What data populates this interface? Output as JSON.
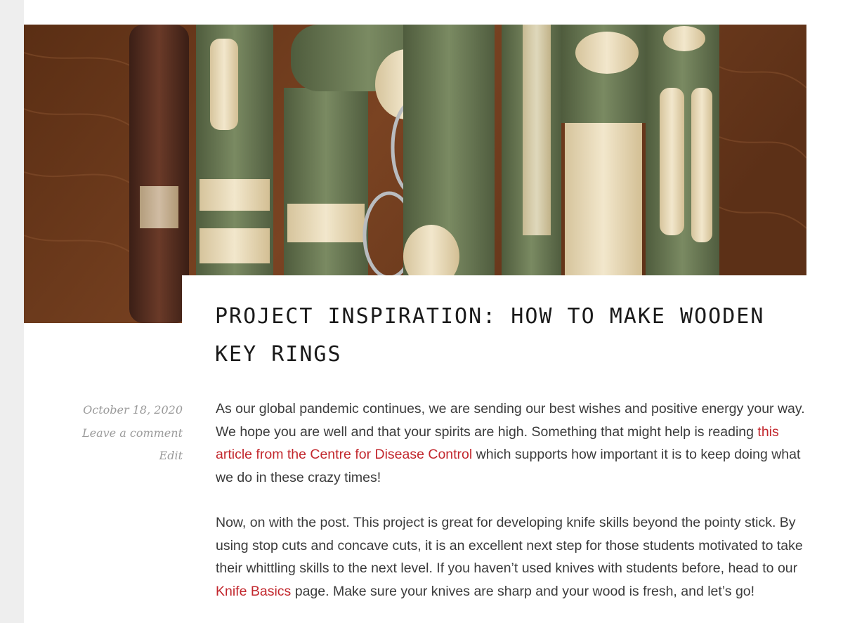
{
  "hero": {
    "image": "wooden-key-rings-photo",
    "colors": {
      "wood_table": "#6b3a1c",
      "bark_green": "#6d7b57",
      "peeled_wood": "#e6d6b3",
      "dark_bark": "#4a2a1e",
      "ring_metal": "#b9bcbf"
    }
  },
  "post": {
    "title": "Project Inspiration: How to make wooden key rings",
    "meta": {
      "date": "October 18, 2020",
      "comment_link": "Leave a comment",
      "edit_link": "Edit"
    },
    "paragraph1": {
      "before": "As our global pandemic continues, we are sending our best wishes and positive energy your way. We hope you are well and that your spirits are high. Something that might help is reading ",
      "link": "this article from the Centre for Disease Control",
      "after": " which supports how important it is to keep doing what we do in these crazy times!"
    },
    "paragraph2": {
      "before": "Now, on with the post. This project is great for developing knife skills beyond the pointy stick. By using stop cuts and concave cuts, it is an excellent next step for those students motivated to take their whittling skills to the next level. If you haven’t used knives with students before, head to our ",
      "link": "Knife Basics",
      "after": " page. Make sure your knives are sharp and your wood is fresh, and let’s go!"
    }
  },
  "colors": {
    "link": "#c2272d",
    "meta_text": "#9a9a9a",
    "body_text": "#3b3b3b",
    "title_text": "#1a1a1a",
    "gutter": "#eeeeee"
  }
}
